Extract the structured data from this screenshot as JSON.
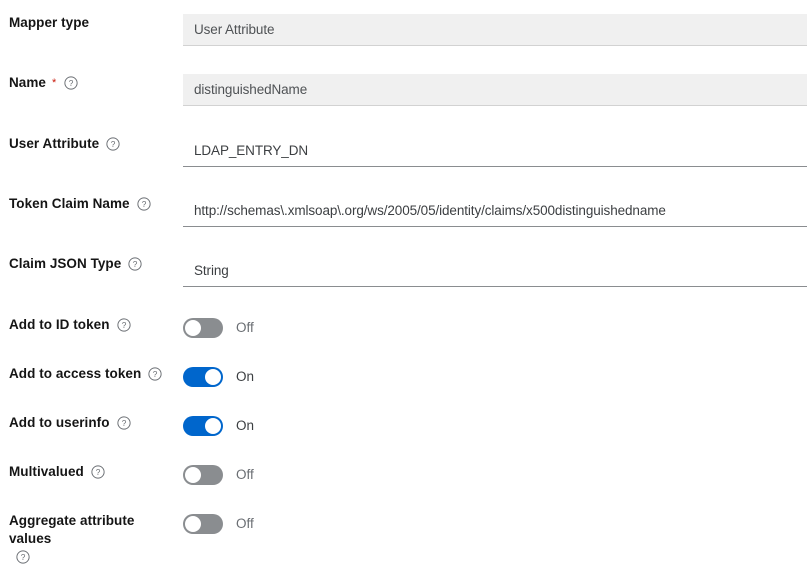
{
  "colors": {
    "accent_on": "#0066cc",
    "toggle_off": "#8a8d90",
    "required_star": "#c9190b",
    "disabled_field_bg": "#f0f0f0",
    "label_text": "#151515",
    "value_text": "#3c3f42"
  },
  "form": {
    "rows": [
      {
        "label": "Mapper type",
        "required_marker": "",
        "has_help": false,
        "type": "text",
        "value": "User Attribute",
        "disabled": true
      },
      {
        "label": "Name",
        "required_marker": "*",
        "has_help": true,
        "type": "text",
        "value": "distinguishedName",
        "disabled": true
      },
      {
        "label": "User Attribute",
        "required_marker": "",
        "has_help": true,
        "type": "text",
        "value": "LDAP_ENTRY_DN",
        "disabled": false
      },
      {
        "label": "Token Claim Name",
        "required_marker": "",
        "has_help": true,
        "type": "text",
        "value": "http://schemas\\.xmlsoap\\.org/ws/2005/05/identity/claims/x500distinguishedname",
        "disabled": false
      },
      {
        "label": "Claim JSON Type",
        "required_marker": "",
        "has_help": true,
        "type": "text",
        "value": "String",
        "disabled": false
      },
      {
        "label": "Add to ID token",
        "required_marker": "",
        "has_help": true,
        "type": "toggle",
        "state": "Off",
        "on": false
      },
      {
        "label": "Add to access token",
        "required_marker": "",
        "has_help": true,
        "type": "toggle",
        "state": "On",
        "on": true
      },
      {
        "label": "Add to userinfo",
        "required_marker": "",
        "has_help": true,
        "type": "toggle",
        "state": "On",
        "on": true
      },
      {
        "label": "Multivalued",
        "required_marker": "",
        "has_help": true,
        "type": "toggle",
        "state": "Off",
        "on": false
      },
      {
        "label": "Aggregate attribute values",
        "required_marker": "",
        "has_help": true,
        "type": "toggle",
        "state": "Off",
        "on": false,
        "label_wraps": true
      }
    ]
  },
  "icons": {
    "help": "help-circle-icon"
  }
}
